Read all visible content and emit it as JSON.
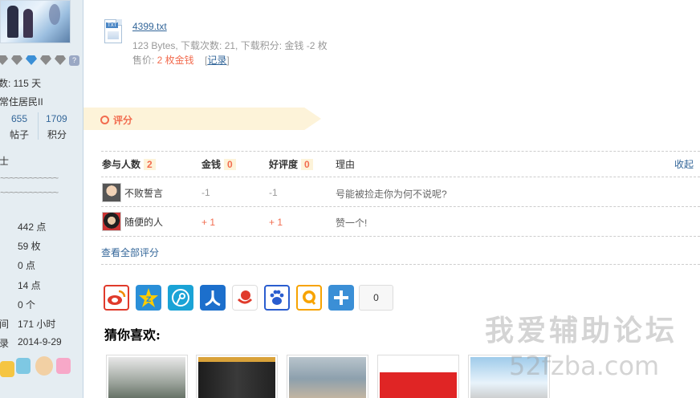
{
  "sidebar": {
    "online_days": "数: 115 天",
    "rank": "常住居民II",
    "posts_value": "655",
    "posts_label": "帖子",
    "score_value": "1709",
    "score_label": "积分",
    "title_text": "士",
    "tilde_line": "~~~~~~~~~~~~",
    "stats": [
      "442 点",
      "59 枚",
      "0 点",
      "14 点",
      "0 个",
      "171 小时",
      "2014-9-29"
    ],
    "stat_prefix_time": "间",
    "stat_prefix_date": "录"
  },
  "attachment": {
    "icon_tag": "TXT",
    "filename": "4399.txt",
    "meta": "123 Bytes, 下载次数: 21, 下载积分: 金钱 -2 枚",
    "price_label": "售价: ",
    "price_value": "2 枚金钱",
    "record_open": "[",
    "record_link": "记录",
    "record_close": "]"
  },
  "rating": {
    "title": "评分",
    "headers": {
      "participants": "参与人数",
      "participants_count": "2",
      "money": "金钱",
      "money_total": "0",
      "goodwill": "好评度",
      "goodwill_total": "0",
      "reason": "理由",
      "collapse": "收起"
    },
    "rows": [
      {
        "name": "不败誓言",
        "money": "-1",
        "goodwill": "-1",
        "reason": "号能被捡走你为何不说呢?"
      },
      {
        "name": "随便的人",
        "money": "+ 1",
        "goodwill": "+ 1",
        "reason": "赞一个!"
      }
    ],
    "view_all": "查看全部评分"
  },
  "share": {
    "icons": [
      "weibo-icon",
      "qzone-icon",
      "tencent-weibo-icon",
      "renren-icon",
      "netease-icon",
      "baidu-icon",
      "qq-icon",
      "more-share-icon"
    ],
    "count": "0"
  },
  "recommend": {
    "title": "猜你喜欢:"
  },
  "watermark": {
    "line1": "我爱辅助论坛",
    "line2": "52fzba.com"
  },
  "colors": {
    "accent": "#f26c4f",
    "link": "#336699",
    "sidebar_bg": "#e5edf2",
    "banner_bg": "#fdf3d9"
  }
}
